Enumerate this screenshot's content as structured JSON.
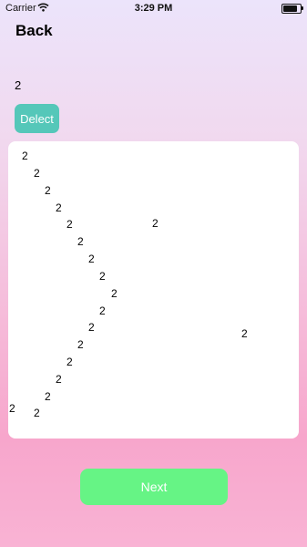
{
  "status_bar": {
    "carrier": "Carrier",
    "time": "3:29 PM",
    "battery_level": 0.85,
    "wifi_icon": "wifi-icon"
  },
  "nav": {
    "back_label": "Back"
  },
  "main": {
    "value_label": "2",
    "detect_label": "Delect",
    "points": [
      "2",
      "2",
      "2",
      "2",
      "2",
      "2",
      "2",
      "2",
      "2",
      "2",
      "2",
      "2",
      "2",
      "2",
      "2",
      "2",
      "2",
      "2",
      "2"
    ],
    "next_label": "Next"
  },
  "colors": {
    "detect_button": "#55c7b9",
    "next_button": "#66f485",
    "panel": "#ffffff"
  }
}
